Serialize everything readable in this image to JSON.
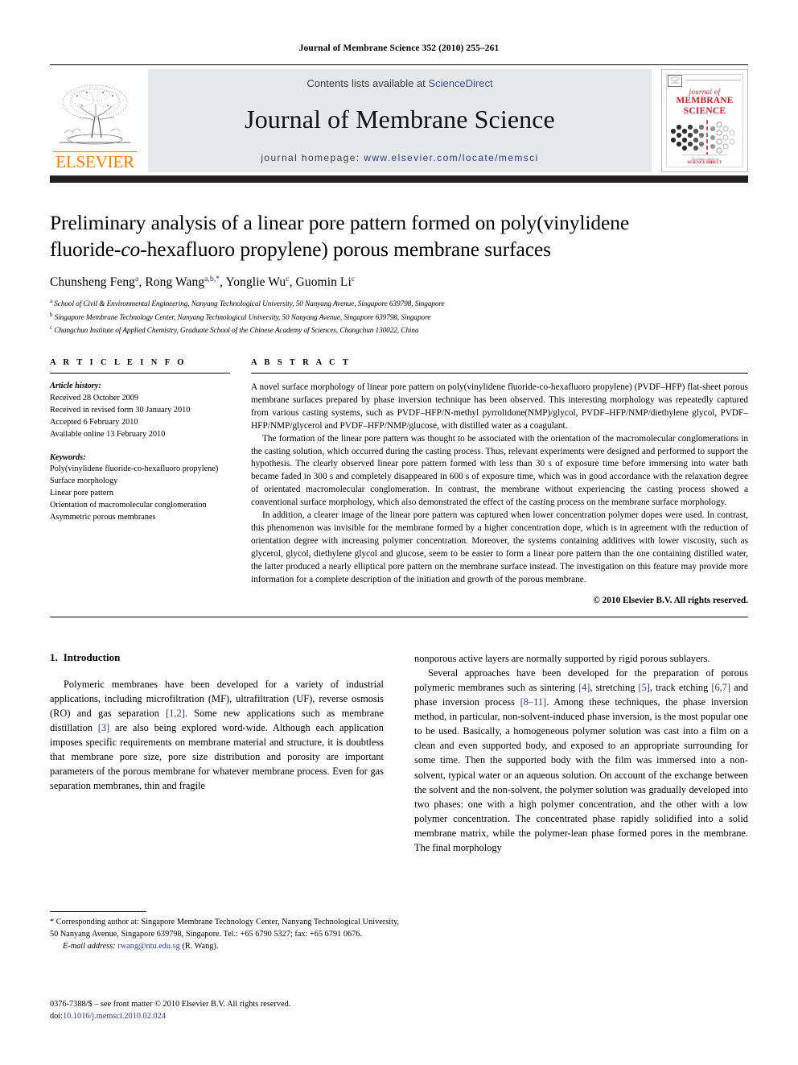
{
  "running_head": "Journal of Membrane Science 352 (2010) 255–261",
  "masthead": {
    "contents_prefix": "Contents lists available at ",
    "contents_link": "ScienceDirect",
    "journal_title": "Journal of Membrane Science",
    "homepage_prefix": "journal homepage: ",
    "homepage_url": "www.elsevier.com/locate/memsci",
    "publisher_wordmark": "ELSEVIER",
    "accent_orange": "#F08000",
    "link_blue": "#2a3b90",
    "band_gray": "#e6e7e8",
    "cover": {
      "line1": "journal of",
      "line2": "MEMBRANE",
      "line3": "SCIENCE",
      "imprint_mark": "ELSEVIER",
      "footer_note": "Available online at",
      "footer_brand": "SCIENCE DIRECT",
      "cover_red": "#cf2027"
    }
  },
  "article": {
    "title_line1": "Preliminary analysis of a linear pore pattern formed on poly(vinylidene",
    "title_line2_a": "fluoride-",
    "title_line2_co": "co",
    "title_line2_b": "-hexafluoro propylene) porous membrane surfaces",
    "authors": [
      {
        "name": "Chunsheng Feng",
        "sup": "a"
      },
      {
        "name": "Rong Wang",
        "sup": "a,b,*"
      },
      {
        "name": "Yonglie Wu",
        "sup": "c"
      },
      {
        "name": "Guomin Li",
        "sup": "c"
      }
    ],
    "affiliations": [
      {
        "mark": "a",
        "text": "School of Civil & Environmental Engineering, Nanyang Technological University, 50 Nanyang Avenue, Singapore 639798, Singapore"
      },
      {
        "mark": "b",
        "text": "Singapore Membrane Technology Center, Nanyang Technological University, 50 Nanyang Avenue, Singapore 639798, Singapore"
      },
      {
        "mark": "c",
        "text": "Changchun Institute of Applied Chemistry, Graduate School of the Chinese Academy of Sciences, Changchun 130022, China"
      }
    ]
  },
  "article_info": {
    "heading": "A R T I C L E   I N F O",
    "history_label": "Article history:",
    "history": [
      "Received 28 October 2009",
      "Received in revised form 30 January 2010",
      "Accepted 6 February 2010",
      "Available online 13 February 2010"
    ],
    "keywords_label": "Keywords:",
    "keywords": [
      "Poly(vinylidene fluoride-co-hexafluoro propylene)",
      "Surface morphology",
      "Linear pore pattern",
      "Orientation of macromolecular conglomeration",
      "Asymmetric porous membranes"
    ]
  },
  "abstract": {
    "heading": "A B S T R A C T",
    "paragraphs": [
      "A novel surface morphology of linear pore pattern on poly(vinylidene fluoride-co-hexafluoro propylene) (PVDF–HFP) flat-sheet porous membrane surfaces prepared by phase inversion technique has been observed. This interesting morphology was repeatedly captured from various casting systems, such as PVDF–HFP/N-methyl pyrrolidone(NMP)/glycol, PVDF–HFP/NMP/diethylene glycol, PVDF–HFP/NMP/glycerol and PVDF–HFP/NMP/glucose, with distilled water as a coagulant.",
      "The formation of the linear pore pattern was thought to be associated with the orientation of the macromolecular conglomerations in the casting solution, which occurred during the casting process. Thus, relevant experiments were designed and performed to support the hypothesis. The clearly observed linear pore pattern formed with less than 30 s of exposure time before immersing into water bath became faded in 300 s and completely disappeared in 600 s of exposure time, which was in good accordance with the relaxation degree of orientated macromolecular conglomeration. In contrast, the membrane without experiencing the casting process showed a conventional surface morphology, which also demonstrated the effect of the casting process on the membrane surface morphology.",
      "In addition, a clearer image of the linear pore pattern was captured when lower concentration polymer dopes were used. In contrast, this phenomenon was invisible for the membrane formed by a higher concentration dope, which is in agreement with the reduction of orientation degree with increasing polymer concentration. Moreover, the systems containing additives with lower viscosity, such as glycerol, glycol, diethylene glycol and glucose, seem to be easier to form a linear pore pattern than the one containing distilled water, the latter produced a nearly elliptical pore pattern on the membrane surface instead. The investigation on this feature may provide more information for a complete description of the initiation and growth of the porous membrane."
    ],
    "copyright": "© 2010 Elsevier B.V. All rights reserved."
  },
  "introduction": {
    "number": "1.",
    "title": "Introduction",
    "left_paragraph_a": "Polymeric membranes have been developed for a variety of industrial applications, including microfiltration (MF), ultrafiltration (UF), reverse osmosis (RO) and gas separation ",
    "left_ref_1": "[1,2]",
    "left_paragraph_b": ". Some new applications such as membrane distillation ",
    "left_ref_2": "[3]",
    "left_paragraph_c": " are also being explored word-wide. Although each application imposes specific requirements on membrane material and structure, it is doubtless that membrane pore size, pore size distribution and porosity are important parameters of the porous membrane for whatever membrane process. Even for gas separation membranes, thin and fragile",
    "right_paragraph_cont": "nonporous active layers are normally supported by rigid porous sublayers.",
    "right_paragraph_a": "Several approaches have been developed for the preparation of porous polymeric membranes such as sintering ",
    "right_ref_4": "[4]",
    "right_paragraph_b": ", stretching ",
    "right_ref_5": "[5]",
    "right_paragraph_c": ", track etching ",
    "right_ref_67": "[6,7]",
    "right_paragraph_d": " and phase inversion process ",
    "right_ref_811": "[8–11]",
    "right_paragraph_e": ". Among these techniques, the phase inversion method, in particular, non-solvent-induced phase inversion, is the most popular one to be used. Basically, a homogeneous polymer solution was cast into a film on a clean and even supported body, and exposed to an appropriate surrounding for some time. Then the supported body with the film was immersed into a non-solvent, typical water or an aqueous solution. On account of the exchange between the solvent and the non-solvent, the polymer solution was gradually developed into two phases: one with a high polymer concentration, and the other with a low polymer concentration. The concentrated phase rapidly solidified into a solid membrane matrix, while the polymer-lean phase formed pores in the membrane. The final morphology"
  },
  "footnote": {
    "corresponding": "* Corresponding author at: Singapore Membrane Technology Center, Nanyang Technological University, 50 Nanyang Avenue, Singapore 639798, Singapore. Tel.: +65 6790 5327; fax: +65 6791 0676.",
    "email_label": "E-mail address:",
    "email": "rwang@ntu.edu.sg",
    "email_owner": "(R. Wang)."
  },
  "imprint": {
    "issn_line": "0376-7388/$ – see front matter © 2010 Elsevier B.V. All rights reserved.",
    "doi_prefix": "doi:",
    "doi": "10.1016/j.memsci.2010.02.024"
  }
}
